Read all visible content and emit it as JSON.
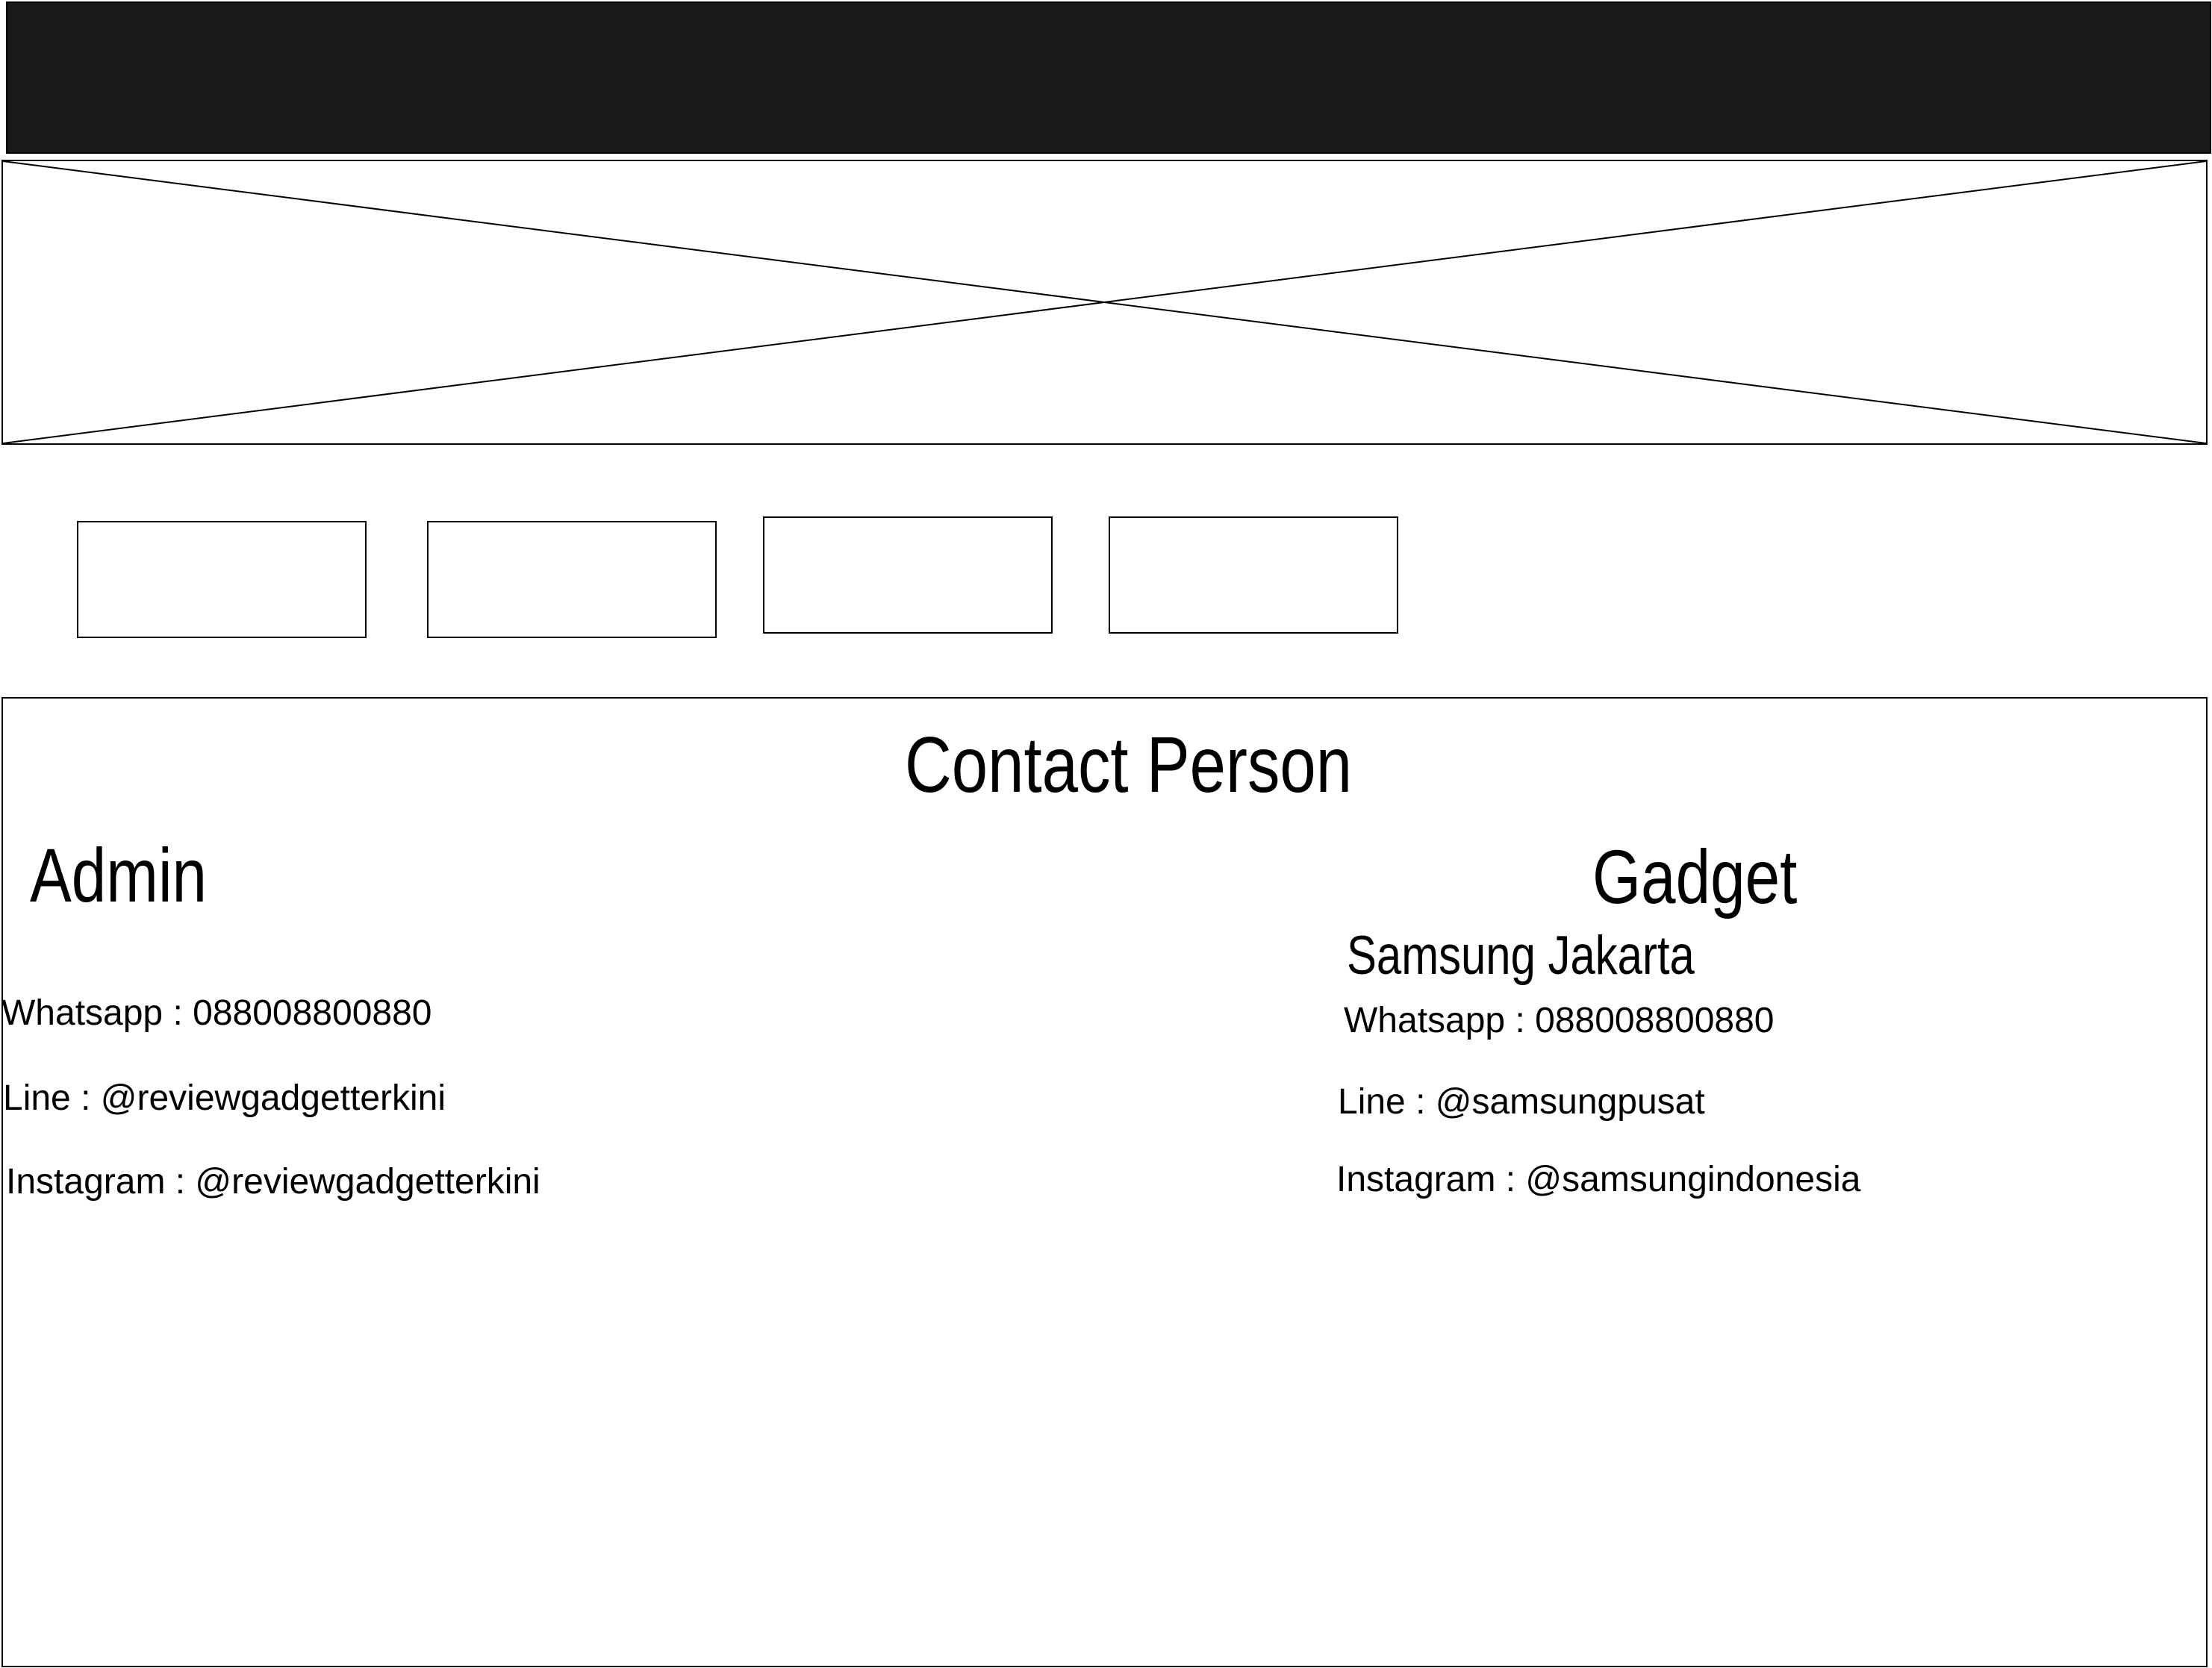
{
  "contact": {
    "title": "Contact Person",
    "admin": {
      "heading": "Admin",
      "whatsapp": "Whatsapp : 088008800880",
      "line": "Line : @reviewgadgetterkini",
      "instagram": "Instagram : @reviewgadgetterkini"
    },
    "gadget": {
      "heading": "Gadget",
      "subheading": "Samsung Jakarta",
      "whatsapp": "Whatsapp : 088008800880",
      "line": "Line : @samsungpusat",
      "instagram": "Instagram : @samsungindonesia"
    }
  },
  "colors": {
    "header": "#1a1a1a",
    "stroke": "#000000",
    "background": "#ffffff"
  }
}
